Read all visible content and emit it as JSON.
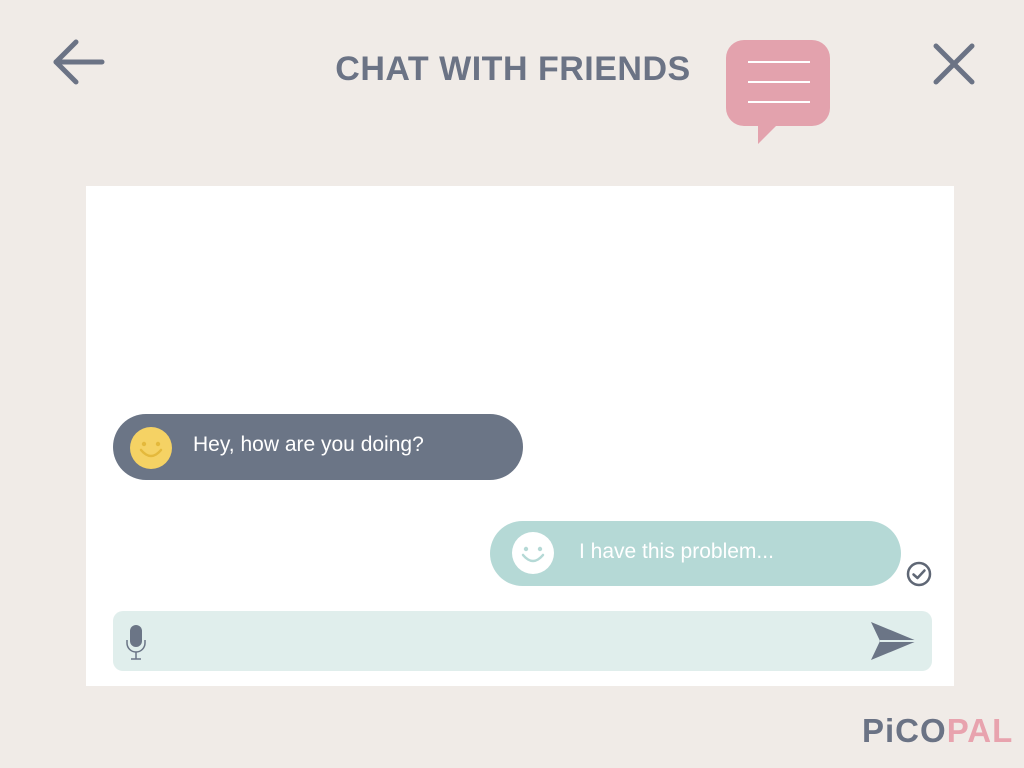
{
  "header": {
    "title": "CHAT WITH FRIENDS",
    "back_icon": "arrow-left-icon",
    "close_icon": "close-icon",
    "logo_icon": "speech-bubble-icon"
  },
  "chat": {
    "messages": [
      {
        "direction": "incoming",
        "avatar_icon": "smiley-icon",
        "text": "Hey, how are you doing?"
      },
      {
        "direction": "outgoing",
        "avatar_icon": "smiley-icon",
        "text": "I have this problem...",
        "status_icon": "check-circle-icon"
      }
    ]
  },
  "composer": {
    "mic_icon": "microphone-icon",
    "send_icon": "send-icon",
    "value": "",
    "placeholder": ""
  },
  "brand": {
    "part1": "PiCO",
    "part2": "PAL"
  },
  "colors": {
    "background": "#f0ebe7",
    "panel": "#ffffff",
    "title_text": "#6b7385",
    "incoming_bubble": "#6b7586",
    "outgoing_bubble": "#b5d9d6",
    "composer_bg": "#e0eeec",
    "accent_pink": "#e3a2ad",
    "smiley_yellow": "#f5d264"
  }
}
